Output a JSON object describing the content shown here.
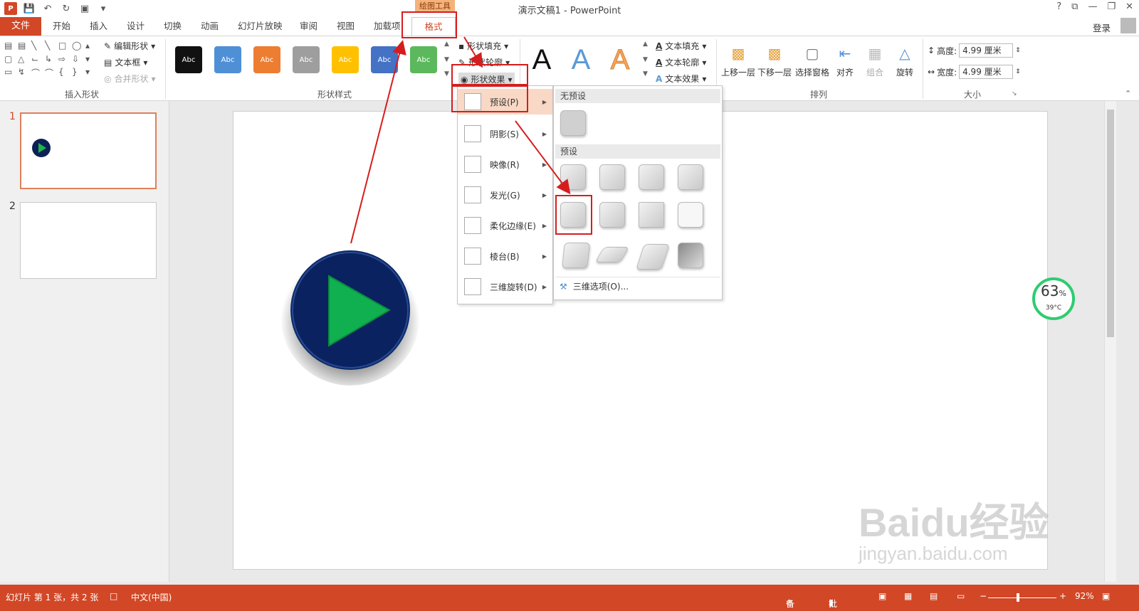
{
  "title_bar": {
    "tool_context_label": "绘图工具",
    "window_title": "演示文稿1 - PowerPoint",
    "controls": [
      "?",
      "⧉",
      "—",
      "❐",
      "✕"
    ]
  },
  "tabs": {
    "file": "文件",
    "items": [
      "开始",
      "插入",
      "设计",
      "切换",
      "动画",
      "幻灯片放映",
      "审阅",
      "视图",
      "加载项"
    ],
    "active": "格式",
    "login": "登录"
  },
  "ribbon": {
    "insert_shapes": {
      "label": "插入形状",
      "edit_shape": "编辑形状",
      "text_box": "文本框",
      "merge_shapes": "合并形状"
    },
    "shape_styles": {
      "label": "形状样式",
      "swatch_text": "Abc",
      "swatch_colors": [
        "#111111",
        "#4f8fd6",
        "#ed7d31",
        "#9e9e9e",
        "#ffc000",
        "#4472c4",
        "#5cb85c"
      ],
      "shape_fill": "形状填充",
      "shape_outline": "形状轮廓",
      "shape_effects": "形状效果"
    },
    "wordart": {
      "letter": "A",
      "text_fill": "文本填充",
      "text_outline": "文本轮廓",
      "text_effects": "文本效果"
    },
    "arrange": {
      "label": "排列",
      "bring_forward": "上移一层",
      "send_backward": "下移一层",
      "selection_pane": "选择窗格",
      "align": "对齐",
      "group": "组合",
      "rotate": "旋转"
    },
    "size": {
      "label": "大小",
      "height_label": "高度:",
      "height_value": "4.99 厘米",
      "width_label": "宽度:",
      "width_value": "4.99 厘米"
    }
  },
  "thumbnails": [
    {
      "number": "1"
    },
    {
      "number": "2"
    }
  ],
  "effects_menu": {
    "items": [
      {
        "label": "预设(P)"
      },
      {
        "label": "阴影(S)"
      },
      {
        "label": "映像(R)"
      },
      {
        "label": "发光(G)"
      },
      {
        "label": "柔化边缘(E)"
      },
      {
        "label": "棱台(B)"
      },
      {
        "label": "三维旋转(D)"
      }
    ]
  },
  "preset_submenu": {
    "no_preset_header": "无预设",
    "preset_header": "预设",
    "options_link": "三维选项(O)..."
  },
  "status_bar": {
    "slide_info": "幻灯片 第 1 张，共 2 张",
    "language": "中文(中国)",
    "notes": "备注",
    "comments": "批注",
    "zoom": "92%"
  },
  "overlay_badge": {
    "percent": "63",
    "percent_sign": "%",
    "temp": "39°C"
  },
  "watermark": {
    "line1": "Baidu经验",
    "line2": "jingyan.baidu.com"
  }
}
